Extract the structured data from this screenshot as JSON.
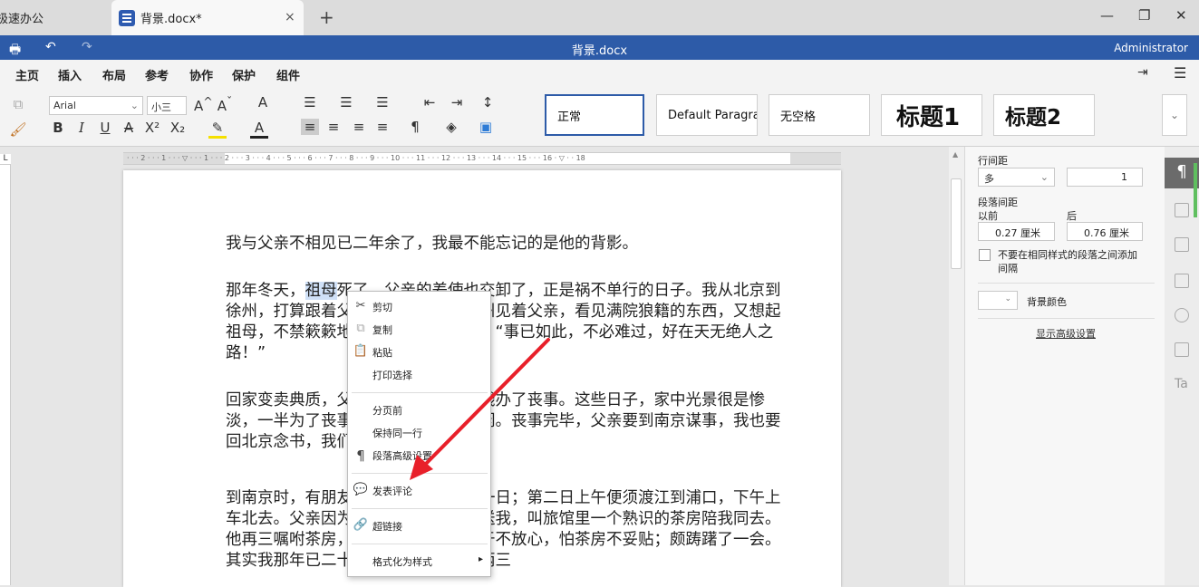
{
  "tabs": [
    {
      "label": "极速办公"
    },
    {
      "label": "背景.docx*"
    }
  ],
  "window": {
    "title": "背景.docx",
    "user": "Administrator",
    "minimize": "—",
    "restore": "❐",
    "close": "✕",
    "new_tab": "+",
    "tab_close": "×"
  },
  "menus": [
    "主页",
    "插入",
    "布局",
    "参考",
    "协作",
    "保护",
    "组件"
  ],
  "toolbar": {
    "font_name": "Arial",
    "font_size": "小三",
    "styles": [
      "正常",
      "Default Paragraph",
      "无空格",
      "标题1",
      "标题2"
    ]
  },
  "ruler": {
    "labels": "· · · 2 · · · 1 · · · ▽ · · · 1 · · · 2 · · · 3 · · · 4 · · · 5 · · · 6 · · · 7 · · · 8 · · · 9 · · · 10 · · · 11 · · · 12 · · · 13 · · · 14 · · · 15 · · · 16 · ▽ · · 18"
  },
  "document": {
    "p1": "我与父亲不相见已二年余了，我最不能忘记的是他的背影。",
    "p2_before": "那年冬天，",
    "p2_selected": "祖母",
    "p2_after": "死了，父亲的差使也交卸了，正是祸不单行的日子。我从北京到徐州，打算跟着父亲奔丧回家。到徐州见着父亲，看见满院狼籍的东西，又想起祖母，不禁簌簌地流下眼泪。父亲说：“事已如此，不必难过，好在天无绝人之路！”",
    "p3": "回家变卖典质，父亲还了亏空；又借钱办了丧事。这些日子，家中光景很是惨淡，一半为了丧事，一半为了父亲赋闲。丧事完毕，父亲要到南京谋事，我也要回北京念书，我们便同行。",
    "p4": "到南京时，有朋友约去游逛，勾留了一日；第二日上午便须渡江到浦口，下午上车北去。父亲因为事忙，本已说定不送我，叫旅馆里一个熟识的茶房陪我同去。他再三嘱咐茶房，甚是仔细。但他终于不放心，怕茶房不妥贴；颇踌躇了一会。其实我那年已二十岁，北京已来往过两三"
  },
  "context_menu": {
    "cut": "剪切",
    "copy": "复制",
    "paste": "粘贴",
    "print_selection": "打印选择",
    "page_break_before": "分页前",
    "keep_lines_together": "保持同一行",
    "paragraph_advanced": "段落高级设置",
    "add_comment": "发表评论",
    "hyperlink": "超链接",
    "format_as_style": "格式化为样式"
  },
  "panel": {
    "line_spacing_label": "行间距",
    "line_spacing_mode": "多",
    "line_spacing_value": "1",
    "para_spacing_label": "段落间距",
    "before_label": "以前",
    "after_label": "后",
    "before_value": "0.27 厘米",
    "after_value": "0.76 厘米",
    "no_space_same_style": "不要在相同样式的段落之间添加间隔",
    "bg_color_label": "背景颜色",
    "show_advanced": "显示高级设置"
  },
  "colors": {
    "accent": "#2d5ba8",
    "arrow": "#e8202a",
    "selection": "#cfe0f7"
  }
}
